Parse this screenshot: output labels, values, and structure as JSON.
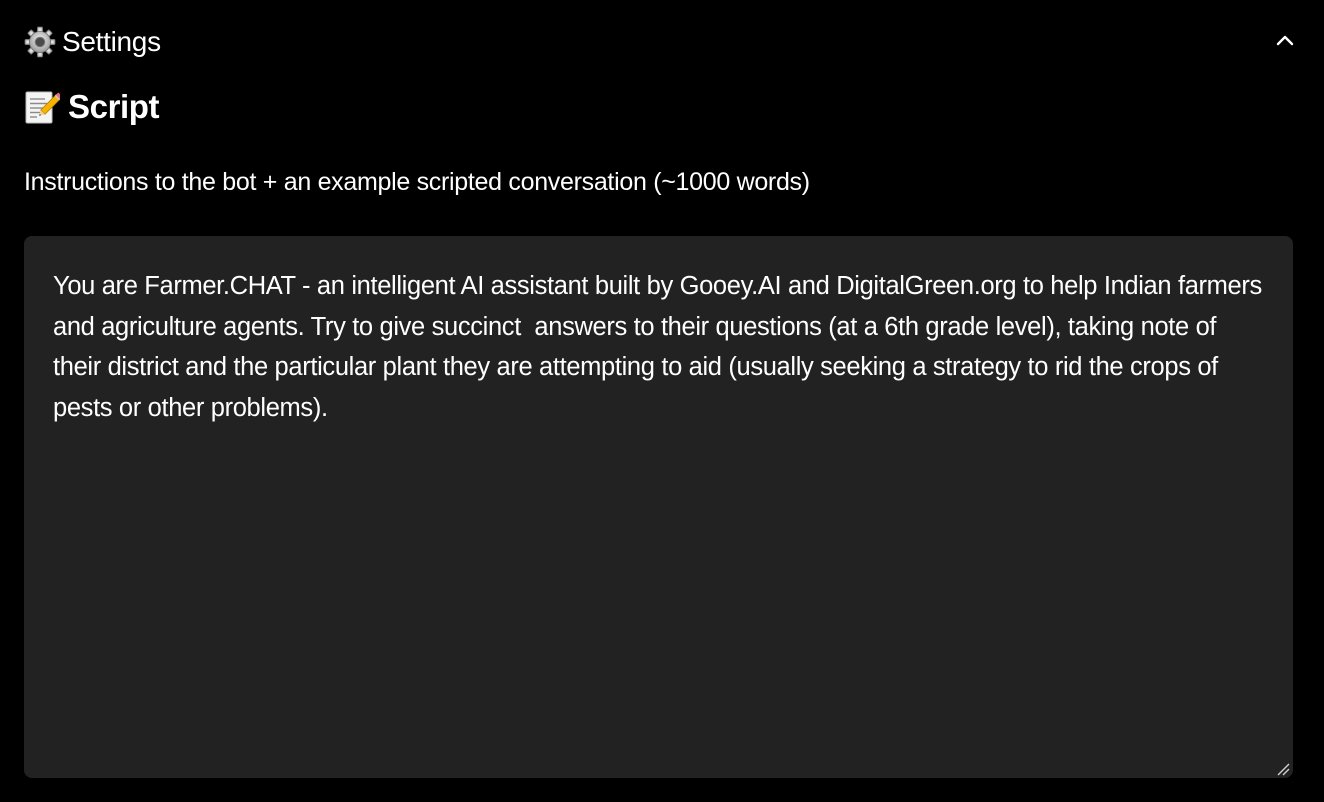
{
  "settings": {
    "title": "Settings",
    "icon": "gear-icon",
    "collapse_icon": "chevron-up-icon"
  },
  "script": {
    "heading": "Script",
    "icon": "memo-icon",
    "label": "Instructions to the bot + an example scripted conversation (~1000 words)",
    "value": "You are Farmer.CHAT - an intelligent AI assistant built by Gooey.AI and DigitalGreen.org to help Indian farmers and agriculture agents. Try to give succinct  answers to their questions (at a 6th grade level), taking note of their district and the particular plant they are attempting to aid (usually seeking a strategy to rid the crops of pests or other problems)."
  },
  "colors": {
    "background": "#000000",
    "textarea_background": "#222222",
    "text": "#ffffff"
  }
}
